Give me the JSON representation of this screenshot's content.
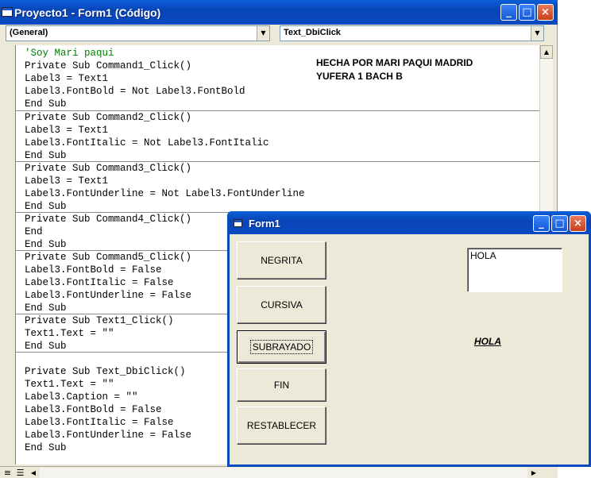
{
  "code_window": {
    "title": "Proyecto1 - Form1 (Código)",
    "controls": {
      "minimize": "_",
      "maximize": "□",
      "close": "×"
    },
    "object_combo": "(General)",
    "procedure_combo": "Text_DbiClick",
    "note": {
      "line1": "HECHA POR MARI PAQUI  MADRID",
      "line2": "YUFERA 1 BACH B"
    },
    "blocks": [
      {
        "lines": [
          "'Soy Mari paqui",
          "Private Sub Command1_Click()",
          "Label3 = Text1",
          "Label3.FontBold = Not Label3.FontBold",
          "End Sub"
        ]
      },
      {
        "lines": [
          "Private Sub Command2_Click()",
          "Label3 = Text1",
          "Label3.FontItalic = Not Label3.FontItalic",
          "End Sub"
        ]
      },
      {
        "lines": [
          "Private Sub Command3_Click()",
          "Label3 = Text1",
          "Label3.FontUnderline = Not Label3.FontUnderline",
          "End Sub"
        ]
      },
      {
        "lines": [
          "Private Sub Command4_Click()",
          "End",
          "End Sub"
        ]
      },
      {
        "lines": [
          "Private Sub Command5_Click()",
          "Label3.FontBold = False",
          "Label3.FontItalic = False",
          "Label3.FontUnderline = False",
          "End Sub"
        ]
      },
      {
        "lines": [
          "Private Sub Text1_Click()",
          "Text1.Text = \"\"",
          "End Sub"
        ]
      },
      {
        "lines": [
          "",
          "Private Sub Text_DbiClick()",
          "Text1.Text = \"\"",
          "Label3.Caption = \"\"",
          "Label3.FontBold = False",
          "Label3.FontItalic = False",
          "Label3.FontUnderline = False",
          "End Sub"
        ]
      }
    ]
  },
  "form_window": {
    "title": "Form1",
    "controls": {
      "minimize": "_",
      "maximize": "□",
      "close": "×"
    },
    "buttons": {
      "negrita": "NEGRITA",
      "cursiva": "CURSIVA",
      "subrayado": "SUBRAYADO",
      "fin": "FIN",
      "restablecer": "RESTABLECER"
    },
    "text1_value": "HOLA",
    "label3_caption": "HOLA"
  },
  "colors": {
    "titlebar": "#0a4ac0",
    "comment": "#008000",
    "window_bg": "#ece9d8"
  }
}
